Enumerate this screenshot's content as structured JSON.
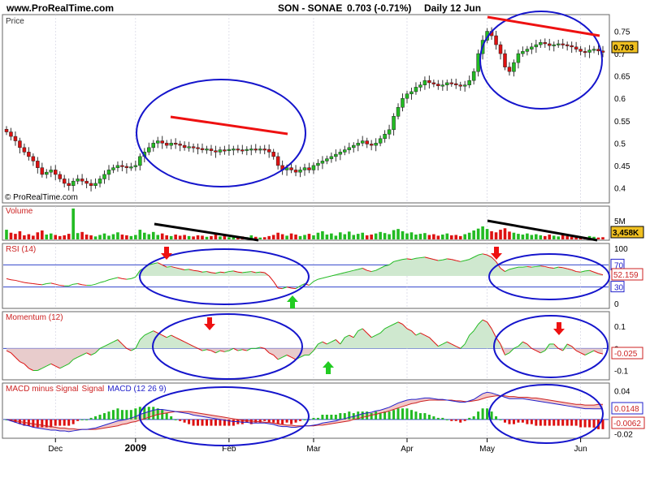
{
  "header": {
    "site": "www.ProRealTime.com",
    "symbol_line": "SON - SONAE",
    "quote": "0.703 (-0.71%)",
    "interval": "Daily 12 Jun"
  },
  "watermark": "© ProRealTime.com",
  "x_axis": {
    "months": [
      {
        "label": "Dec",
        "i": 11
      },
      {
        "label": "2009",
        "i": 29,
        "bold": true
      },
      {
        "label": "Feb",
        "i": 50
      },
      {
        "label": "Mar",
        "i": 69
      },
      {
        "label": "Apr",
        "i": 90
      },
      {
        "label": "May",
        "i": 108
      },
      {
        "label": "Jun",
        "i": 129
      }
    ]
  },
  "colors": {
    "up": "#22bb22",
    "down": "#dd1111",
    "circle": "#1515cc",
    "trend_red": "#ee1111",
    "trend_black": "#000000",
    "grid": "#7777aa"
  },
  "chart_data": [
    {
      "type": "candlestick",
      "panel": "price",
      "title": "Price",
      "y_ticks": [
        0.4,
        0.45,
        0.5,
        0.55,
        0.6,
        0.65,
        0.7,
        0.75
      ],
      "ylim": [
        0.37,
        0.78
      ],
      "last_value": "0.703",
      "dates_span": "Nov 2008 – 12 Jun 2009",
      "close": [
        0.525,
        0.515,
        0.505,
        0.49,
        0.48,
        0.47,
        0.46,
        0.445,
        0.43,
        0.435,
        0.44,
        0.43,
        0.42,
        0.41,
        0.405,
        0.415,
        0.42,
        0.415,
        0.41,
        0.405,
        0.41,
        0.42,
        0.43,
        0.44,
        0.445,
        0.45,
        0.448,
        0.445,
        0.447,
        0.45,
        0.47,
        0.48,
        0.49,
        0.5,
        0.505,
        0.5,
        0.495,
        0.5,
        0.498,
        0.495,
        0.49,
        0.492,
        0.49,
        0.488,
        0.485,
        0.487,
        0.483,
        0.48,
        0.485,
        0.483,
        0.486,
        0.487,
        0.485,
        0.484,
        0.486,
        0.487,
        0.485,
        0.487,
        0.486,
        0.48,
        0.47,
        0.45,
        0.44,
        0.445,
        0.44,
        0.435,
        0.44,
        0.445,
        0.44,
        0.45,
        0.455,
        0.46,
        0.465,
        0.47,
        0.475,
        0.48,
        0.485,
        0.49,
        0.495,
        0.5,
        0.505,
        0.498,
        0.495,
        0.5,
        0.51,
        0.52,
        0.53,
        0.56,
        0.58,
        0.6,
        0.61,
        0.615,
        0.625,
        0.63,
        0.64,
        0.635,
        0.632,
        0.628,
        0.63,
        0.635,
        0.633,
        0.63,
        0.628,
        0.63,
        0.64,
        0.66,
        0.7,
        0.73,
        0.75,
        0.74,
        0.72,
        0.7,
        0.67,
        0.66,
        0.68,
        0.7,
        0.705,
        0.71,
        0.715,
        0.72,
        0.725,
        0.722,
        0.718,
        0.72,
        0.722,
        0.72,
        0.718,
        0.715,
        0.71,
        0.705,
        0.703,
        0.708,
        0.71,
        0.706,
        0.703
      ]
    },
    {
      "type": "bar",
      "panel": "volume",
      "title": "Volume",
      "y_ticks": [
        "5M"
      ],
      "last_value": "3,458K",
      "values": [
        2.6,
        1.8,
        1.5,
        2.2,
        1.1,
        1.4,
        1.0,
        1.9,
        2.4,
        1.3,
        1.6,
        1.2,
        0.9,
        1.1,
        1.5,
        8.3,
        1.7,
        2.0,
        1.3,
        1.1,
        0.8,
        1.2,
        1.6,
        1.0,
        1.4,
        1.9,
        1.3,
        1.1,
        0.9,
        1.2,
        2.6,
        1.8,
        1.4,
        2.0,
        1.2,
        1.6,
        1.1,
        0.9,
        1.3,
        1.0,
        1.2,
        0.9,
        0.8,
        1.1,
        1.0,
        0.7,
        0.9,
        1.3,
        0.8,
        1.0,
        0.6,
        0.9,
        0.7,
        0.8,
        0.6,
        1.1,
        0.7,
        0.5,
        0.6,
        0.9,
        1.2,
        1.8,
        1.4,
        1.0,
        1.6,
        1.3,
        0.9,
        1.2,
        1.5,
        1.1,
        1.8,
        2.2,
        1.3,
        1.6,
        1.0,
        1.9,
        1.4,
        2.1,
        1.2,
        1.5,
        1.8,
        1.1,
        1.3,
        1.6,
        2.0,
        1.7,
        1.4,
        2.5,
        2.8,
        2.2,
        1.6,
        1.9,
        1.3,
        1.5,
        1.7,
        1.2,
        1.4,
        1.0,
        1.3,
        1.6,
        1.1,
        1.2,
        0.9,
        1.4,
        1.8,
        2.4,
        2.9,
        3.5,
        2.8,
        2.2,
        1.9,
        2.6,
        3.0,
        2.1,
        1.8,
        1.5,
        1.3,
        1.6,
        1.2,
        1.4,
        1.1,
        0.9,
        1.3,
        1.0,
        0.8,
        1.2,
        0.9,
        0.7,
        1.0,
        0.8,
        0.6,
        0.9,
        0.7,
        0.5,
        0.6,
        0.7
      ]
    },
    {
      "type": "line",
      "panel": "rsi",
      "title": "RSI (14)",
      "y_ticks": [
        0,
        30,
        50,
        70,
        100
      ],
      "last_value": "52.159",
      "values": [
        45,
        43,
        42,
        40,
        38,
        37,
        36,
        35,
        34,
        36,
        37,
        35,
        33,
        32,
        32,
        35,
        36,
        34,
        33,
        33,
        35,
        38,
        40,
        43,
        45,
        47,
        45,
        44,
        45,
        48,
        60,
        65,
        70,
        72,
        74,
        70,
        66,
        67,
        65,
        63,
        61,
        62,
        60,
        59,
        57,
        58,
        56,
        55,
        57,
        56,
        58,
        59,
        57,
        56,
        57,
        58,
        56,
        57,
        56,
        50,
        40,
        28,
        27,
        30,
        28,
        27,
        32,
        36,
        33,
        40,
        44,
        46,
        48,
        50,
        52,
        54,
        56,
        58,
        60,
        62,
        64,
        60,
        58,
        60,
        64,
        68,
        70,
        76,
        78,
        80,
        81,
        80,
        82,
        83,
        84,
        82,
        80,
        78,
        79,
        81,
        80,
        78,
        76,
        78,
        80,
        84,
        88,
        90,
        88,
        84,
        76,
        64,
        58,
        62,
        64,
        66,
        66,
        67,
        66,
        67,
        68,
        67,
        65,
        64,
        66,
        65,
        63,
        61,
        58,
        57,
        59,
        60,
        57,
        54,
        52
      ]
    },
    {
      "type": "area",
      "panel": "momentum",
      "title": "Momentum (12)",
      "y_ticks": [
        -0.1,
        0,
        0.1
      ],
      "last_value": "-0.025",
      "values": [
        -0.01,
        -0.02,
        -0.04,
        -0.06,
        -0.07,
        -0.09,
        -0.1,
        -0.1,
        -0.09,
        -0.08,
        -0.07,
        -0.08,
        -0.09,
        -0.08,
        -0.07,
        -0.05,
        -0.04,
        -0.03,
        -0.02,
        -0.03,
        -0.02,
        0.0,
        0.01,
        0.02,
        0.03,
        0.04,
        0.02,
        0.0,
        -0.01,
        0.0,
        0.04,
        0.06,
        0.07,
        0.08,
        0.07,
        0.06,
        0.05,
        0.06,
        0.05,
        0.04,
        0.03,
        0.02,
        0.01,
        0.0,
        -0.01,
        -0.005,
        -0.01,
        -0.02,
        -0.01,
        -0.015,
        -0.01,
        0.0,
        -0.01,
        -0.005,
        -0.01,
        0.0,
        0.0,
        0.005,
        0.0,
        -0.02,
        -0.03,
        -0.05,
        -0.04,
        -0.03,
        -0.04,
        -0.05,
        -0.04,
        -0.03,
        -0.03,
        -0.01,
        0.02,
        0.03,
        0.02,
        0.03,
        0.04,
        0.02,
        0.05,
        0.06,
        0.05,
        0.08,
        0.09,
        0.07,
        0.05,
        0.06,
        0.07,
        0.09,
        0.1,
        0.11,
        0.12,
        0.11,
        0.09,
        0.08,
        0.06,
        0.07,
        0.06,
        0.05,
        0.03,
        0.01,
        0.02,
        0.03,
        0.02,
        0.01,
        0.0,
        0.02,
        0.06,
        0.08,
        0.11,
        0.13,
        0.12,
        0.09,
        0.05,
        0.02,
        -0.03,
        -0.02,
        0.0,
        0.01,
        0.03,
        0.02,
        0.0,
        -0.01,
        -0.02,
        -0.01,
        0.02,
        0.02,
        0.0,
        -0.01,
        0.02,
        0.01,
        -0.01,
        -0.02,
        -0.03,
        -0.02,
        -0.01,
        -0.02,
        -0.025
      ]
    },
    {
      "type": "line+histogram",
      "panel": "macd",
      "title": "MACD minus Signal Signal MACD (12 26 9)",
      "title_parts": {
        "a": "MACD minus Signal",
        "b": "Signal",
        "c": "MACD (12 26 9)"
      },
      "y_ticks": [
        -0.02,
        0,
        0.02,
        0.04
      ],
      "last_values": {
        "macd": "0.0148",
        "histogram": "-0.0062"
      },
      "macd": [
        0.0,
        -0.002,
        -0.004,
        -0.006,
        -0.008,
        -0.009,
        -0.011,
        -0.012,
        -0.013,
        -0.014,
        -0.015,
        -0.015,
        -0.016,
        -0.016,
        -0.017,
        -0.016,
        -0.015,
        -0.014,
        -0.014,
        -0.013,
        -0.012,
        -0.01,
        -0.008,
        -0.006,
        -0.004,
        -0.002,
        -0.001,
        0.0,
        0.002,
        0.004,
        0.007,
        0.009,
        0.011,
        0.013,
        0.014,
        0.014,
        0.013,
        0.012,
        0.011,
        0.01,
        0.009,
        0.008,
        0.006,
        0.005,
        0.004,
        0.003,
        0.002,
        0.001,
        0.0,
        -0.001,
        -0.002,
        -0.003,
        -0.003,
        -0.004,
        -0.004,
        -0.005,
        -0.005,
        -0.005,
        -0.005,
        -0.006,
        -0.007,
        -0.009,
        -0.01,
        -0.01,
        -0.011,
        -0.011,
        -0.01,
        -0.009,
        -0.009,
        -0.008,
        -0.007,
        -0.005,
        -0.004,
        -0.003,
        -0.002,
        0.0,
        0.001,
        0.003,
        0.004,
        0.006,
        0.008,
        0.009,
        0.01,
        0.012,
        0.013,
        0.015,
        0.017,
        0.02,
        0.023,
        0.025,
        0.027,
        0.028,
        0.028,
        0.029,
        0.03,
        0.03,
        0.029,
        0.028,
        0.028,
        0.027,
        0.026,
        0.025,
        0.024,
        0.024,
        0.026,
        0.028,
        0.032,
        0.036,
        0.038,
        0.037,
        0.035,
        0.033,
        0.031,
        0.029,
        0.029,
        0.029,
        0.029,
        0.028,
        0.027,
        0.026,
        0.025,
        0.024,
        0.023,
        0.022,
        0.021,
        0.02,
        0.019,
        0.018,
        0.017,
        0.016,
        0.015,
        0.015,
        0.0148,
        0.0148,
        0.0148
      ],
      "signal": [
        0.0,
        -0.001,
        -0.002,
        -0.003,
        -0.004,
        -0.005,
        -0.006,
        -0.007,
        -0.008,
        -0.009,
        -0.01,
        -0.011,
        -0.012,
        -0.012,
        -0.013,
        -0.013,
        -0.014,
        -0.014,
        -0.014,
        -0.014,
        -0.014,
        -0.013,
        -0.012,
        -0.011,
        -0.01,
        -0.009,
        -0.007,
        -0.006,
        -0.004,
        -0.003,
        -0.001,
        0.001,
        0.003,
        0.005,
        0.007,
        0.008,
        0.009,
        0.01,
        0.011,
        0.011,
        0.011,
        0.011,
        0.01,
        0.009,
        0.008,
        0.007,
        0.006,
        0.005,
        0.004,
        0.003,
        0.002,
        0.001,
        0.0,
        -0.001,
        -0.002,
        -0.002,
        -0.003,
        -0.003,
        -0.004,
        -0.004,
        -0.005,
        -0.006,
        -0.007,
        -0.008,
        -0.008,
        -0.009,
        -0.009,
        -0.009,
        -0.009,
        -0.009,
        -0.008,
        -0.008,
        -0.007,
        -0.006,
        -0.005,
        -0.004,
        -0.003,
        -0.002,
        0.0,
        0.001,
        0.003,
        0.004,
        0.006,
        0.007,
        0.009,
        0.01,
        0.012,
        0.014,
        0.016,
        0.018,
        0.02,
        0.022,
        0.023,
        0.025,
        0.026,
        0.027,
        0.027,
        0.027,
        0.027,
        0.027,
        0.027,
        0.026,
        0.026,
        0.025,
        0.025,
        0.026,
        0.027,
        0.029,
        0.031,
        0.032,
        0.033,
        0.033,
        0.033,
        0.032,
        0.032,
        0.031,
        0.031,
        0.031,
        0.03,
        0.03,
        0.029,
        0.028,
        0.027,
        0.026,
        0.025,
        0.024,
        0.023,
        0.022,
        0.021,
        0.021,
        0.02,
        0.02,
        0.02,
        0.021,
        0.021
      ]
    }
  ]
}
